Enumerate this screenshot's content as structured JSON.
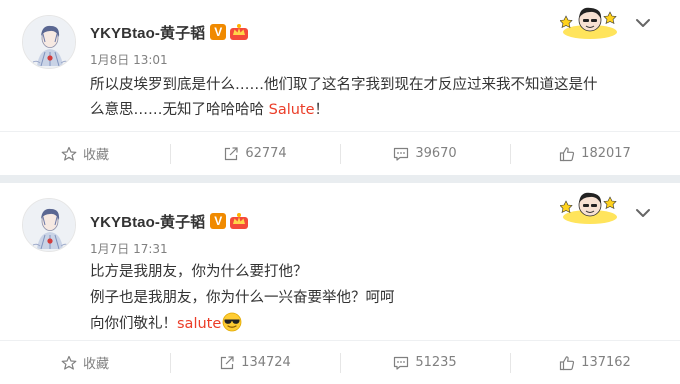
{
  "posts": [
    {
      "author": "YKYBtao-黄子韬",
      "time": "1月8日 13:01",
      "text_line1": "所以皮埃罗到底是什么……他们取了这名字我到现在才反应过来我不知道这是什",
      "text_line2_main": "么意思……无知了哈哈哈哈 ",
      "text_line2_highlight": "Salute",
      "text_line2_tail": "！",
      "actions": {
        "favorite_label": "收藏",
        "repost_count": "62774",
        "comment_count": "39670",
        "like_count": "182017"
      }
    },
    {
      "author": "YKYBtao-黄子韬",
      "time": "1月7日 17:31",
      "text_line1": "比方是我朋友，你为什么要打他？",
      "text_line2": "例子也是我朋友，你为什么一兴奋要举他？呵呵",
      "text_line3_main": "向你们敬礼！",
      "text_line3_highlight": "salute",
      "actions": {
        "favorite_label": "收藏",
        "repost_count": "134724",
        "comment_count": "51235",
        "like_count": "137162"
      }
    }
  ],
  "colors": {
    "highlight": "#eb3d28",
    "verified_badge": "#f08a00",
    "meta_text": "#808080",
    "page_background": "#e9edf0"
  },
  "icons": {
    "favorite": "star-outline-icon",
    "repost": "share-square-icon",
    "comment": "comment-bubble-icon",
    "like": "thumbs-up-icon",
    "menu": "chevron-down-icon"
  }
}
